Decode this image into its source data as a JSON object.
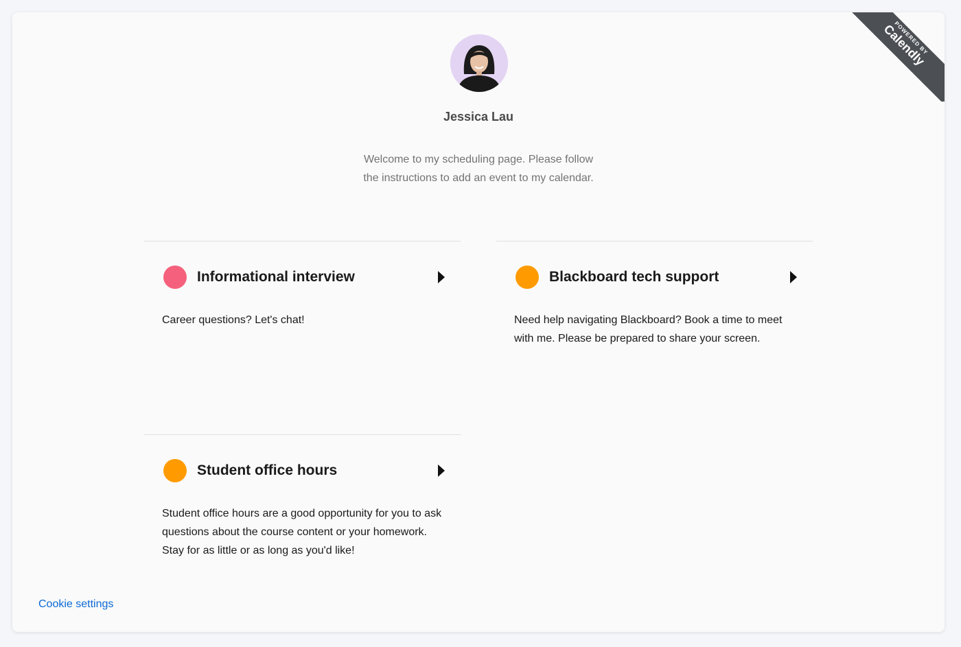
{
  "ribbon": {
    "top_text": "POWERED BY",
    "brand": "Calendly"
  },
  "profile": {
    "name": "Jessica Lau",
    "welcome": "Welcome to my scheduling page. Please follow the instructions to add an event to my calendar."
  },
  "events": [
    {
      "title": "Informational interview",
      "description": "Career questions? Let's chat!",
      "color": "#f5617c"
    },
    {
      "title": "Blackboard tech support",
      "description": "Need help navigating Blackboard? Book a time to meet with me. Please be prepared to share your screen.",
      "color": "#ff9b00"
    },
    {
      "title": "Student office hours",
      "description": "Student office hours are a good opportunity for you to ask questions about the course content or your homework. Stay for as little or as long as you'd like!",
      "color": "#ff9b00"
    }
  ],
  "footer": {
    "cookie_settings": "Cookie settings"
  },
  "colors": {
    "link": "#0b69d4",
    "ribbon_bg": "#4c4f54",
    "page_bg": "#f4f6fa"
  }
}
